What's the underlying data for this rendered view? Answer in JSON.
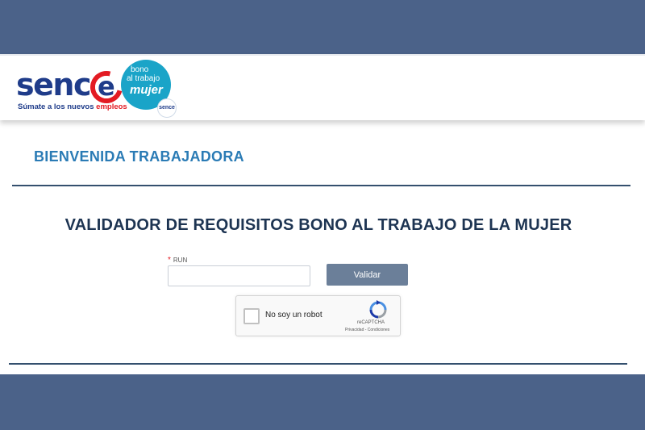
{
  "header": {
    "logo": {
      "wordmark": "senc",
      "wordmark_e": "e",
      "tagline_prefix": "Súmate a los nuevos ",
      "tagline_highlight": "empleos",
      "brand_color": "#1f3c8a",
      "accent_color": "#e31b23"
    },
    "bono_logo": {
      "line1": "bono",
      "line2": "al trabajo",
      "line3": "mujer",
      "badge": "sence",
      "color": "#1aa4c8"
    }
  },
  "main": {
    "welcome": "BIENVENIDA TRABAJADORA",
    "title": "VALIDADOR DE REQUISITOS BONO AL TRABAJO DE LA MUJER",
    "form": {
      "required_mark": "*",
      "run_label": "RUN",
      "run_value": "",
      "run_placeholder": "",
      "submit_label": "Validar"
    },
    "recaptcha": {
      "label": "No soy un robot",
      "brand": "reCAPTCHA",
      "links": "Privacidad - Condiciones"
    }
  },
  "colors": {
    "frame_band": "#4b6289",
    "rule": "#34506e",
    "button": "#6b7f99",
    "welcome_text": "#2a7bb5",
    "title_text": "#1d3452"
  }
}
